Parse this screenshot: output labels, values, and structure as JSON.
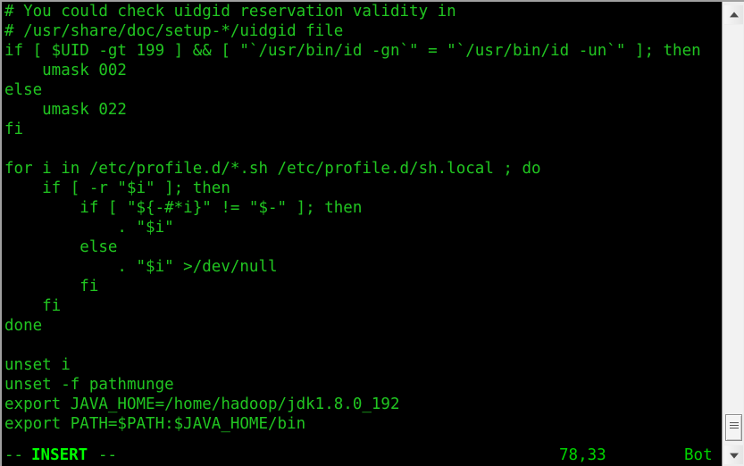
{
  "window": {
    "type": "terminal",
    "application": "vim",
    "background_color": "#000000",
    "text_color": "#21c521",
    "bold_color": "#00ff00"
  },
  "editor": {
    "lines": [
      "# You could check uidgid reservation validity in",
      "# /usr/share/doc/setup-*/uidgid file",
      "if [ $UID -gt 199 ] && [ \"`/usr/bin/id -gn`\" = \"`/usr/bin/id -un`\" ]; then",
      "    umask 002",
      "else",
      "    umask 022",
      "fi",
      "",
      "for i in /etc/profile.d/*.sh /etc/profile.d/sh.local ; do",
      "    if [ -r \"$i\" ]; then",
      "        if [ \"${-#*i}\" != \"$-\" ]; then",
      "            . \"$i\"",
      "        else",
      "            . \"$i\" >/dev/null",
      "        fi",
      "    fi",
      "done",
      "",
      "unset i",
      "unset -f pathmunge",
      "export JAVA_HOME=/home/hadoop/jdk1.8.0_192",
      "export PATH=$PATH:$JAVA_HOME/bin"
    ]
  },
  "status_line": {
    "dash_left": "--",
    "mode": "INSERT",
    "dash_right": "--",
    "cursor_position": "78,33",
    "file_location": "Bot"
  },
  "scrollbar": {
    "up_arrow_icon": "scrollbar-up-arrow-icon",
    "down_arrow_icon": "scrollbar-down-arrow-icon",
    "thumb_position": "bottom"
  }
}
